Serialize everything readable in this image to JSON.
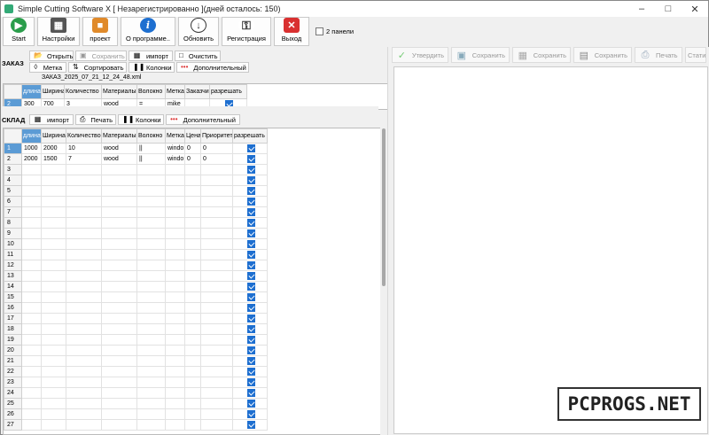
{
  "window": {
    "title": "Simple Cutting Software X [ Незарегистрированно ](дней осталось: 150)"
  },
  "toolbar": {
    "start": "Start",
    "settings": "Настройки",
    "project": "проект",
    "about": "О программе..",
    "update": "Обновить",
    "register": "Регистрация",
    "exit": "Выход",
    "two_panels": "2 панели"
  },
  "order": {
    "section": "ЗАКАЗ",
    "open": "Открыть",
    "save": "Сохранить",
    "import": "импорт",
    "clear": "Очистить",
    "label": "Метка",
    "sort": "Сортировать",
    "columns": "Колонки",
    "extra": "Дополнительный",
    "filename": "ЗАКАЗ_2025_07_21_12_24_48.xml",
    "headers": [
      "",
      "длина",
      "Ширина",
      "Количество",
      "Материалы",
      "Волокно",
      "Метка",
      "Заказчик",
      "разрешать"
    ],
    "rows": [
      {
        "n": "2",
        "length": "300",
        "width": "700",
        "qty": "3",
        "material": "wood",
        "grain": "=",
        "label": "mike",
        "customer": "",
        "allow": true
      }
    ]
  },
  "stock": {
    "section": "СКЛАД",
    "import": "импорт",
    "print": "Печать",
    "columns": "Колонки",
    "extra": "Дополнительный",
    "headers": [
      "",
      "длина",
      "Ширина",
      "Количество",
      "Материалы",
      "Волокно",
      "Метка",
      "Цена",
      "Приоритет",
      "разрешать"
    ],
    "rows": [
      {
        "n": "1",
        "length": "1000",
        "width": "2000",
        "qty": "10",
        "material": "wood",
        "grain": "||",
        "label": "windo",
        "price": "0",
        "priority": "0",
        "allow": true
      },
      {
        "n": "2",
        "length": "2000",
        "width": "1500",
        "qty": "7",
        "material": "wood",
        "grain": "||",
        "label": "windo",
        "price": "0",
        "priority": "0",
        "allow": true
      }
    ],
    "empty_rows": [
      "3",
      "4",
      "5",
      "6",
      "7",
      "8",
      "9",
      "10",
      "11",
      "12",
      "13",
      "14",
      "15",
      "16",
      "17",
      "18",
      "19",
      "20",
      "21",
      "22",
      "23",
      "24",
      "25",
      "26",
      "27"
    ]
  },
  "right": {
    "approve": "Утвердить",
    "save1": "Сохранить",
    "save2": "Сохранить",
    "save3": "Сохранить",
    "print": "Печать",
    "stats": "Стати"
  },
  "watermark": "PCPROGS.NET",
  "colors": {
    "accent": "#5b9bd5",
    "check": "#1e6fd0"
  }
}
